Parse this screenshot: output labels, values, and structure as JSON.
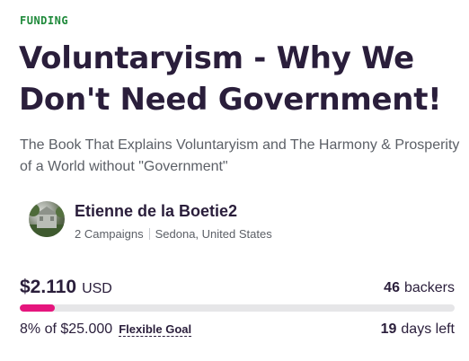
{
  "campaign": {
    "eyebrow": "FUNDING",
    "title": "Voluntaryism - Why We Don't Need Government!",
    "subtitle": "The Book That Explains Voluntaryism and The Harmony & Prosperity of a World without \"Government\""
  },
  "owner": {
    "name": "Etienne de la Boetie2",
    "campaigns": "2 Campaigns",
    "location": "Sedona, United States"
  },
  "funding": {
    "raised_amount": "$2.110",
    "currency": "USD",
    "backers_count": "46",
    "backers_label": "backers",
    "progress_percent": 8,
    "goal_text": "8% of $25.000",
    "goal_type": "Flexible Goal",
    "days_count": "19",
    "days_label": "days left"
  },
  "colors": {
    "accent": "#e5157d",
    "eyebrow": "#1f8a3b",
    "heading": "#2a1e3b"
  }
}
